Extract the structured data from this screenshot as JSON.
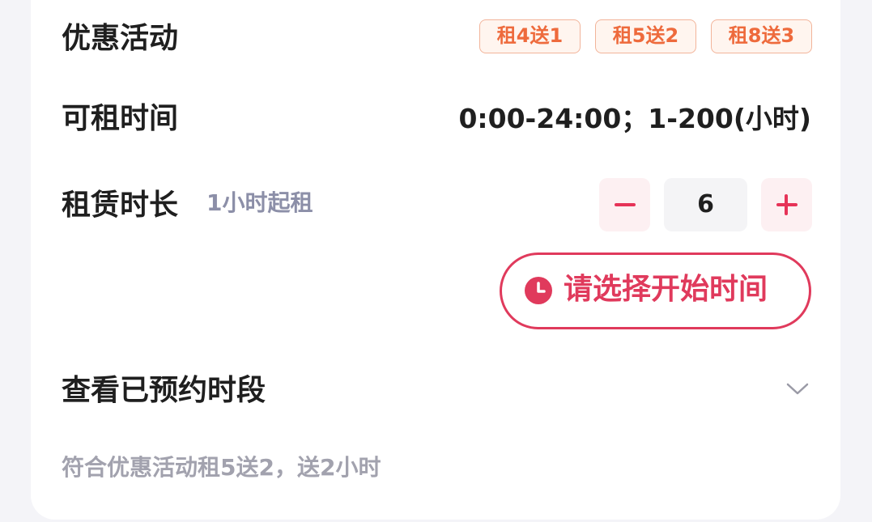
{
  "promotions": {
    "label": "优惠活动",
    "tags": [
      "租4送1",
      "租5送2",
      "租8送3"
    ]
  },
  "rental_hours": {
    "label": "可租时间",
    "value": "0:00-24:00；1-200(小时)"
  },
  "duration": {
    "label": "租赁时长",
    "hint": "1小时起租",
    "value": "6",
    "decrement_icon": "minus-icon",
    "increment_icon": "plus-icon"
  },
  "start_time_button": {
    "label": "请选择开始时间",
    "icon": "clock-icon"
  },
  "booked_slots": {
    "label": "查看已预约时段",
    "icon": "chevron-down-icon"
  },
  "promo_note": "符合优惠活动租5送2，送2小时",
  "colors": {
    "accent": "#e03a5c",
    "tag_text": "#ee6a3c",
    "tag_border": "#f2b49a",
    "tag_bg": "#fff5ef",
    "muted": "#8c8fa8"
  }
}
